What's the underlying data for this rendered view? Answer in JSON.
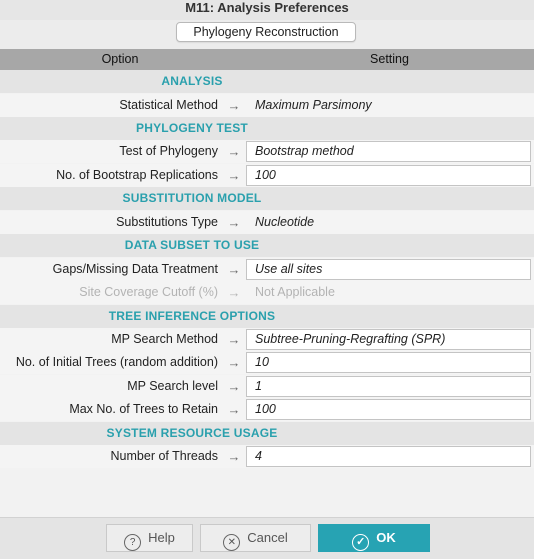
{
  "window": {
    "title": "M11: Analysis Preferences"
  },
  "tab": {
    "label": "Phylogeny Reconstruction"
  },
  "table_header": {
    "option": "Option",
    "setting": "Setting"
  },
  "rows": [
    {
      "kind": "section",
      "label": "ANALYSIS"
    },
    {
      "kind": "item",
      "option": "Statistical Method",
      "value": "Maximum Parsimony",
      "editable": false
    },
    {
      "kind": "section",
      "label": "PHYLOGENY TEST"
    },
    {
      "kind": "item",
      "option": "Test of Phylogeny",
      "value": "Bootstrap method",
      "editable": true
    },
    {
      "kind": "item",
      "option": "No. of Bootstrap Replications",
      "value": "100",
      "editable": true
    },
    {
      "kind": "section",
      "label": "SUBSTITUTION MODEL"
    },
    {
      "kind": "item",
      "option": "Substitutions Type",
      "value": "Nucleotide",
      "editable": false
    },
    {
      "kind": "section",
      "label": "DATA SUBSET TO USE"
    },
    {
      "kind": "item",
      "option": "Gaps/Missing Data Treatment",
      "value": "Use all sites",
      "editable": true
    },
    {
      "kind": "item",
      "option": "Site Coverage Cutoff (%)",
      "value": "Not Applicable",
      "editable": false,
      "disabled": true
    },
    {
      "kind": "section",
      "label": "TREE INFERENCE OPTIONS"
    },
    {
      "kind": "item",
      "option": "MP Search Method",
      "value": "Subtree-Pruning-Regrafting (SPR)",
      "editable": true
    },
    {
      "kind": "item",
      "option": "No. of Initial Trees (random addition)",
      "value": "10",
      "editable": true
    },
    {
      "kind": "item",
      "option": "MP Search level",
      "value": "1",
      "editable": true
    },
    {
      "kind": "item",
      "option": "Max No. of Trees to Retain",
      "value": "100",
      "editable": true
    },
    {
      "kind": "section",
      "label": "SYSTEM RESOURCE USAGE"
    },
    {
      "kind": "item",
      "option": "Number of Threads",
      "value": "4",
      "editable": true
    }
  ],
  "arrow_glyph": "→",
  "buttons": {
    "help": {
      "label": "Help",
      "icon": "?"
    },
    "cancel": {
      "label": "Cancel",
      "icon": "✕"
    },
    "ok": {
      "label": "OK",
      "icon": "✓"
    }
  },
  "colors": {
    "accent": "#27a3b3",
    "section_text": "#2aa0ad",
    "header_bg": "#a7a7a7"
  }
}
